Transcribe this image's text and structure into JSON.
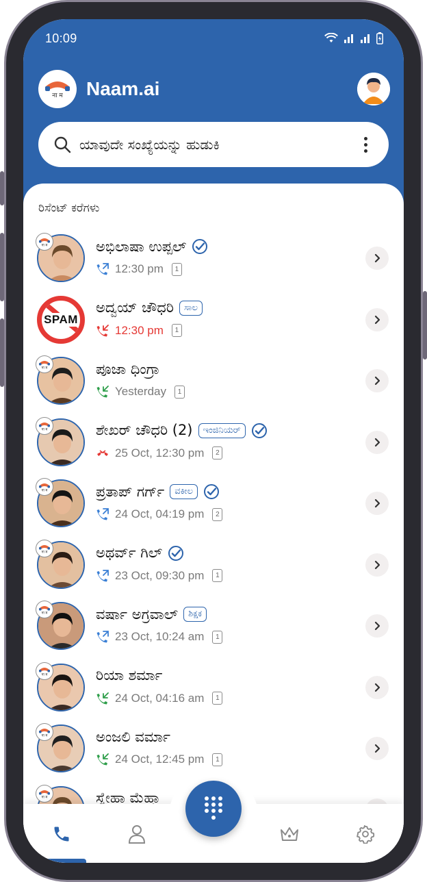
{
  "status_bar": {
    "time": "10:09"
  },
  "app": {
    "name": "Naam.ai"
  },
  "search": {
    "placeholder": "ಯಾವುದೇ ಸಂಖ್ಯೆಯನ್ನು ಹುಡುಕಿ"
  },
  "recent": {
    "title": "ರಿಸೆಂಟ್ ಕರೆಗಳು",
    "calls": [
      {
        "name": "ಅಭಿಲಾಷಾ ಉಪ್ಪಲ್",
        "tag": "",
        "verified": true,
        "call_type": "outgoing",
        "time": "12:30 pm",
        "count": "1",
        "avatar": "photo"
      },
      {
        "name": "ಅದ್ವಯ್ ಚೌಧರಿ",
        "tag": "ಸಾಲ",
        "verified": false,
        "call_type": "missed",
        "time": "12:30 pm",
        "count": "1",
        "avatar": "spam",
        "avatar_text": "SPAM"
      },
      {
        "name": "ಪೂಜಾ ಧಿಂಗ್ರಾ",
        "tag": "",
        "verified": false,
        "call_type": "incoming",
        "time": "Yesterday",
        "count": "1",
        "avatar": "photo"
      },
      {
        "name": "ಶೇಖರ್ ಚೌಧರಿ (2)",
        "tag": "ಇಂಜಿನಿಯರ್",
        "verified": true,
        "call_type": "declined",
        "time": "25 Oct, 12:30 pm",
        "count": "2",
        "avatar": "photo"
      },
      {
        "name": "ಪ್ರತಾಪ್ ಗರ್ಗ್",
        "tag": "ವಕೀಲ",
        "verified": true,
        "call_type": "outgoing",
        "time": "24 Oct, 04:19 pm",
        "count": "2",
        "avatar": "photo"
      },
      {
        "name": "ಅಥರ್ವ್ ಗಿಲ್",
        "tag": "",
        "verified": true,
        "call_type": "outgoing",
        "time": "23 Oct, 09:30 pm",
        "count": "1",
        "avatar": "photo"
      },
      {
        "name": "ವರ್ಷಾ ಅಗ್ರವಾಲ್",
        "tag": "ಶಿಕ್ಷಕ",
        "verified": false,
        "call_type": "outgoing",
        "time": "23 Oct, 10:24 am",
        "count": "1",
        "avatar": "photo"
      },
      {
        "name": "ರಿಯಾ ಶರ್ಮಾ",
        "tag": "",
        "verified": false,
        "call_type": "incoming",
        "time": "24 Oct, 04:16 am",
        "count": "1",
        "avatar": "photo"
      },
      {
        "name": "ಅಂಜಲಿ ವರ್ಮಾ",
        "tag": "",
        "verified": false,
        "call_type": "incoming",
        "time": "24 Oct, 12:45 pm",
        "count": "1",
        "avatar": "photo"
      },
      {
        "name": "ಸ್ನೇಹಾ ಮೆಹ್ತಾ",
        "tag": "",
        "verified": false,
        "call_type": "outgoing",
        "time": "",
        "count": "",
        "avatar": "photo"
      }
    ]
  },
  "nav": {
    "items": [
      "phone-icon",
      "contacts-icon",
      "premium-crown-icon",
      "settings-gear-icon"
    ],
    "active": "phone-icon"
  },
  "colors": {
    "primary": "#2d64ac",
    "missed": "#e53935",
    "incoming": "#2e9e4a",
    "outgoing": "#3a7fd5"
  }
}
